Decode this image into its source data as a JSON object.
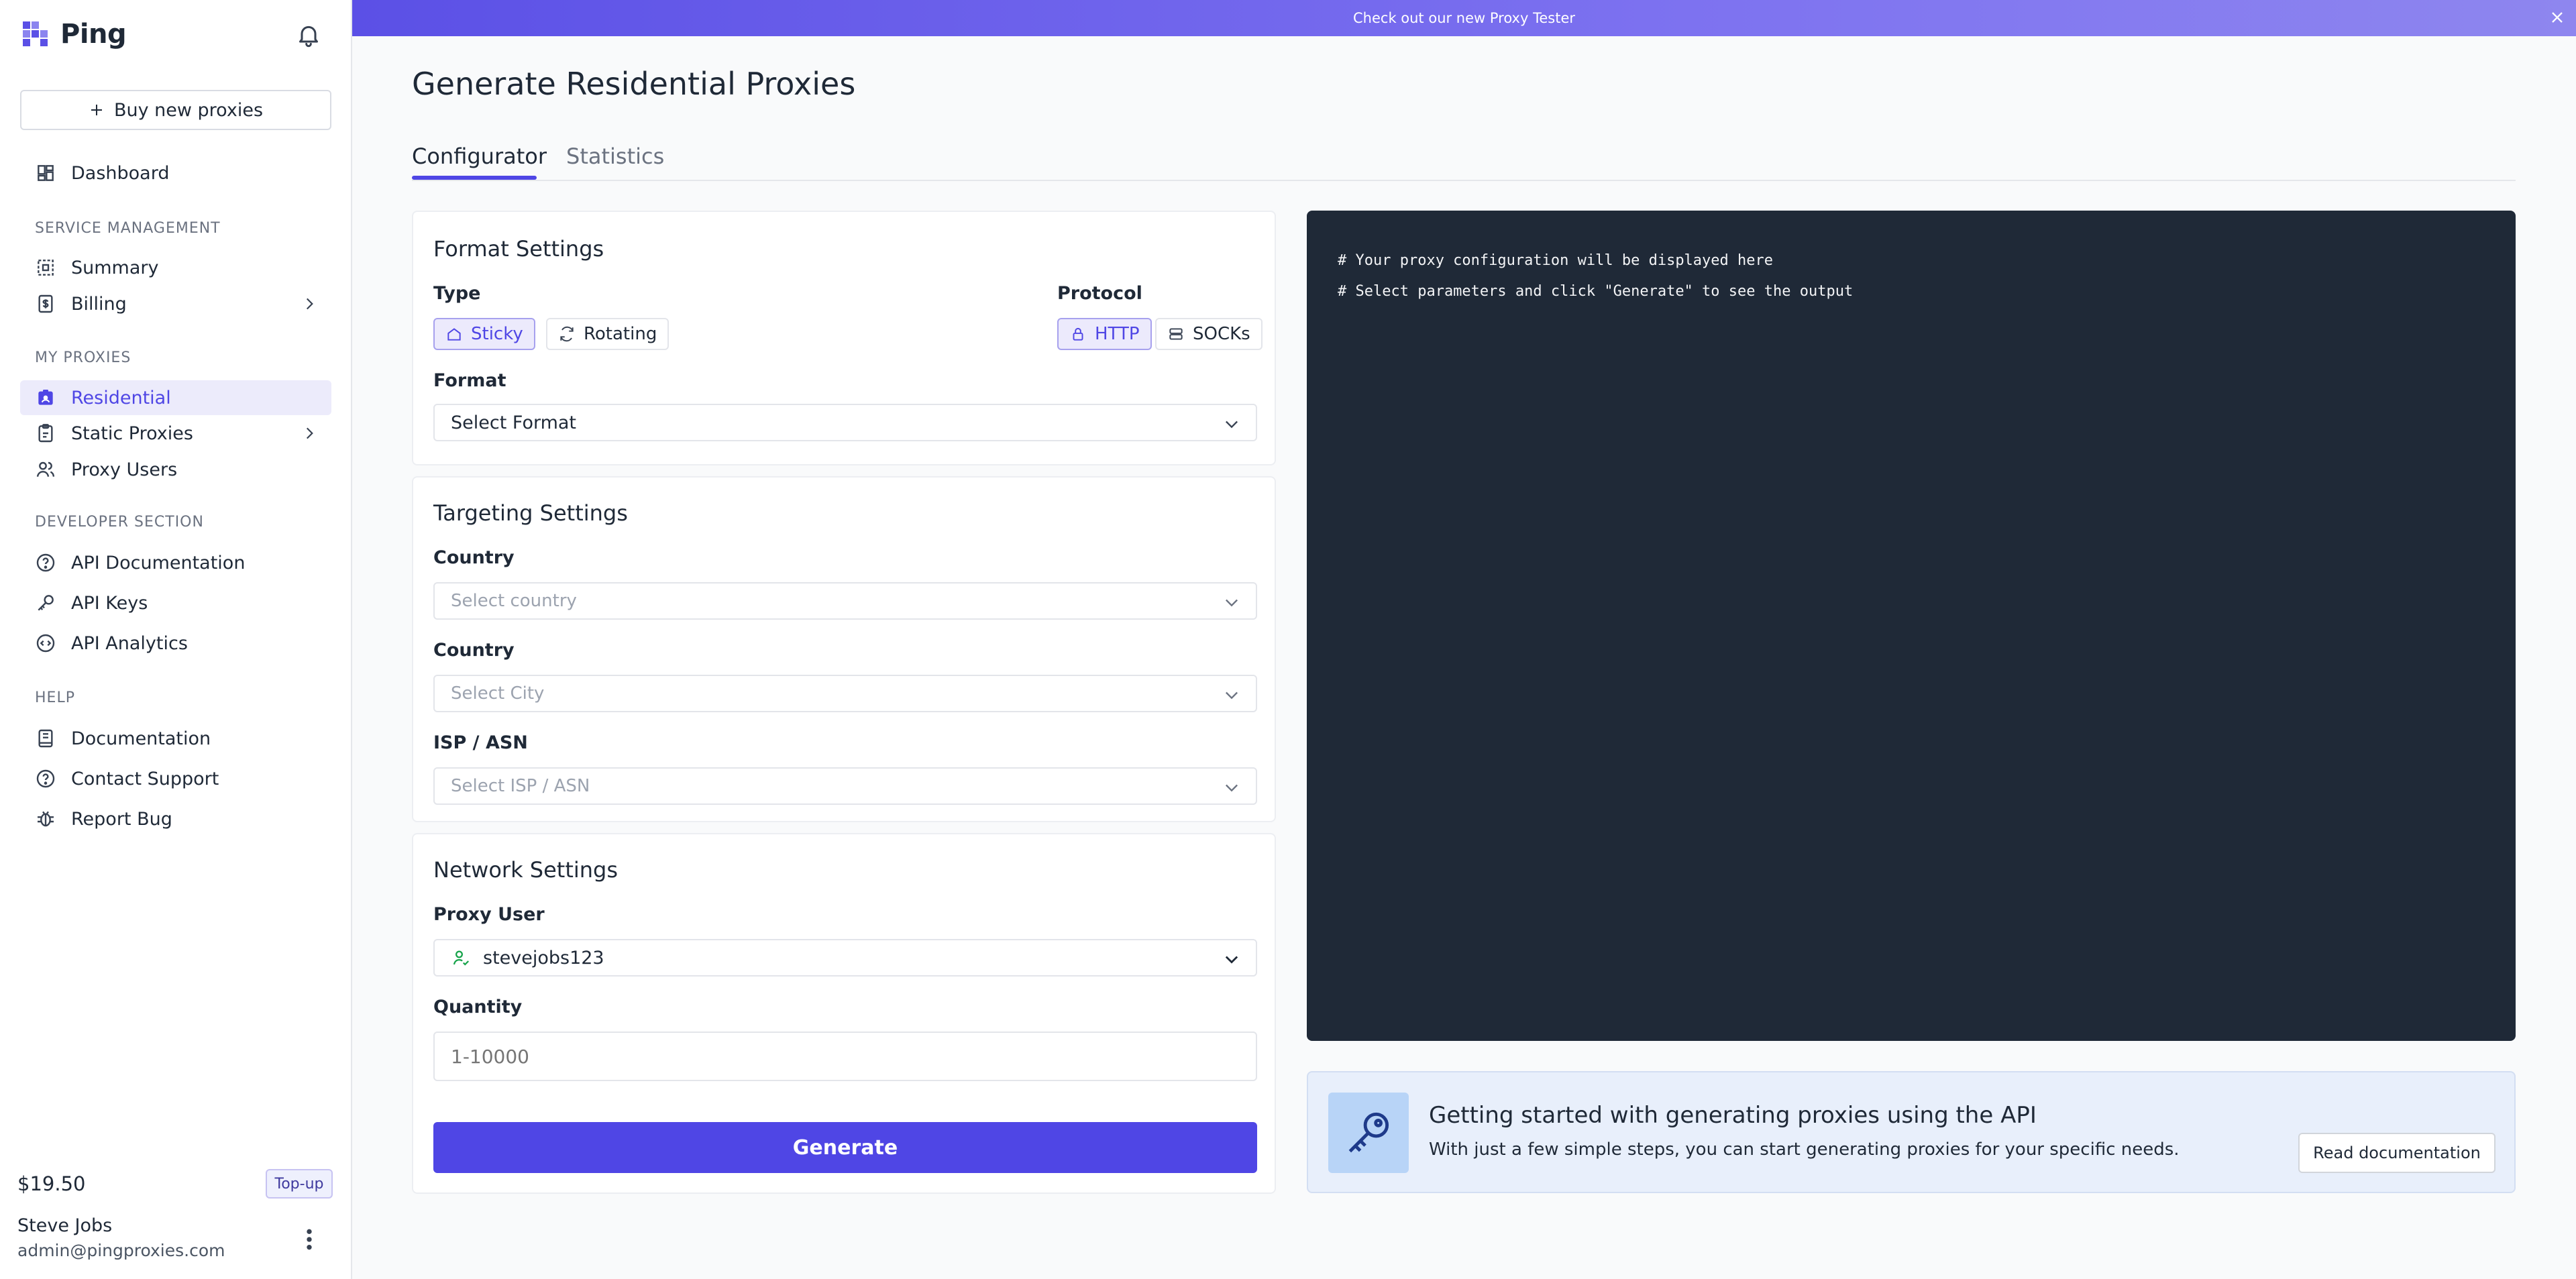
{
  "app": {
    "name": "Ping"
  },
  "sidebar": {
    "buy_label": "Buy new proxies",
    "dashboard": "Dashboard",
    "sections": {
      "service": "SERVICE MANAGEMENT",
      "proxies": "MY PROXIES",
      "developer": "DEVELOPER SECTION",
      "help": "HELP"
    },
    "items": {
      "summary": "Summary",
      "billing": "Billing",
      "residential": "Residential",
      "static": "Static Proxies",
      "proxy_users": "Proxy Users",
      "api_docs": "API Documentation",
      "api_keys": "API Keys",
      "api_analytics": "API Analytics",
      "documentation": "Documentation",
      "contact": "Contact Support",
      "report_bug": "Report Bug"
    },
    "balance": "$19.50",
    "topup_label": "Top-up",
    "user": {
      "name": "Steve Jobs",
      "email": "admin@pingproxies.com"
    }
  },
  "banner": {
    "text": "Check out our new Proxy Tester"
  },
  "main": {
    "title": "Generate Residential Proxies",
    "tabs": [
      "Configurator",
      "Statistics"
    ],
    "format": {
      "title": "Format Settings",
      "type_label": "Type",
      "type_options": [
        "Sticky",
        "Rotating"
      ],
      "protocol_label": "Protocol",
      "protocol_options": [
        "HTTP",
        "SOCKs"
      ],
      "format_label": "Format",
      "format_value": "Select Format"
    },
    "targeting": {
      "title": "Targeting Settings",
      "country_label": "Country",
      "country_placeholder": "Select country",
      "city_label": "Country",
      "city_placeholder": "Select City",
      "isp_label": "ISP / ASN",
      "isp_placeholder": "Select ISP / ASN"
    },
    "network": {
      "title": "Network Settings",
      "proxy_user_label": "Proxy User",
      "proxy_user_value": "stevejobs123",
      "quantity_label": "Quantity",
      "quantity_placeholder": "1-10000"
    },
    "generate_label": "Generate",
    "output": {
      "line1": "# Your proxy configuration will be displayed here",
      "line2": "# Select parameters and click \"Generate\" to see the output"
    },
    "getting_started": {
      "title": "Getting started with generating proxies using the API",
      "description": "With just a few simple steps, you can start generating proxies for your specific needs.",
      "button": "Read documentation"
    }
  },
  "colors": {
    "accent": "#4f46e5",
    "output_bg": "#1f2937",
    "banner": "#6c63ea"
  }
}
